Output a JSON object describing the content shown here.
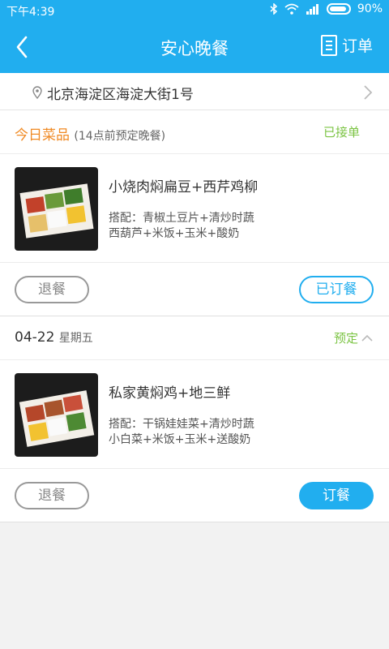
{
  "status_bar": {
    "time": "下午4:39",
    "battery": "90%"
  },
  "header": {
    "title": "安心晚餐",
    "orders_label": "订单"
  },
  "address": {
    "text": "北京海淀区海淀大街1号"
  },
  "today": {
    "label": "今日菜品",
    "note": "(14点前预定晚餐)",
    "status": "已接单",
    "meal": {
      "name": "小烧肉焖扁豆+西芹鸡柳",
      "combo_line1": "搭配：青椒土豆片+清炒时蔬",
      "combo_line2": "西葫芦+米饭+玉米+酸奶"
    },
    "cancel_label": "退餐",
    "ordered_label": "已订餐"
  },
  "next": {
    "date": "04-22",
    "weekday": "星期五",
    "status": "预定",
    "meal": {
      "name": "私家黄焖鸡+地三鲜",
      "combo_line1": "搭配：干锅娃娃菜+清炒时蔬",
      "combo_line2": "小白菜+米饭+玉米+送酸奶"
    },
    "cancel_label": "退餐",
    "order_label": "订餐"
  },
  "colors": {
    "primary": "#21aeef",
    "accent_orange": "#f08a24",
    "status_green": "#7cc444"
  }
}
